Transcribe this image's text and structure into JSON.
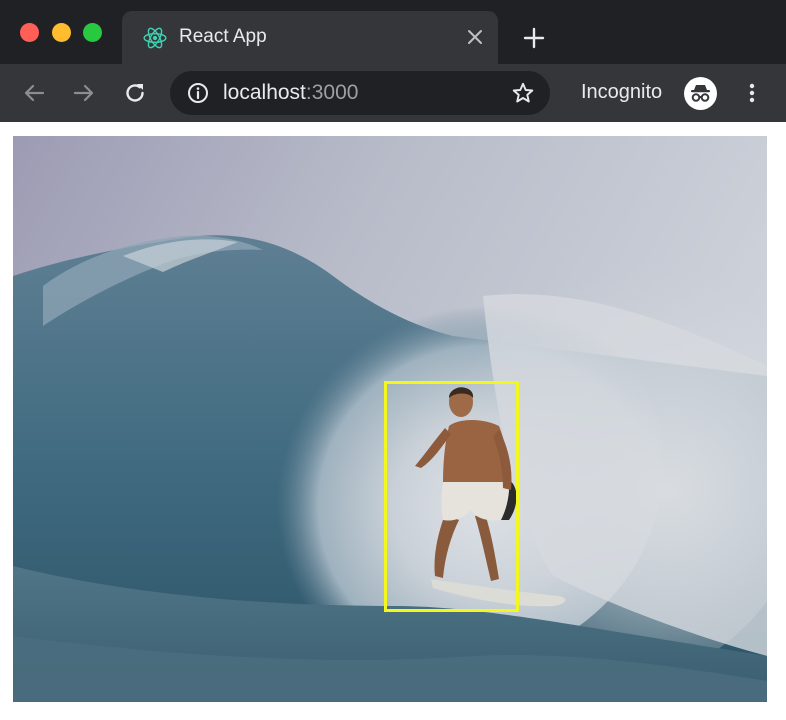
{
  "browser": {
    "tab": {
      "title": "React App",
      "favicon": "react-logo-icon"
    },
    "address": {
      "host": "localhost",
      "port": ":3000"
    },
    "profile_label": "Incognito",
    "icons": {
      "back": "arrow-left-icon",
      "forward": "arrow-right-icon",
      "reload": "reload-icon",
      "info": "info-icon",
      "bookmark": "star-icon",
      "menu": "kebab-menu-icon",
      "new_tab": "plus-icon",
      "close_tab": "close-icon",
      "incognito": "incognito-icon"
    }
  },
  "page": {
    "image_subject": "surfer riding a wave",
    "detection": {
      "box_color": "#f4f71c"
    }
  },
  "colors": {
    "frame_dark": "#202124",
    "frame_mid": "#35363a",
    "react_accent": "#61dafb"
  }
}
